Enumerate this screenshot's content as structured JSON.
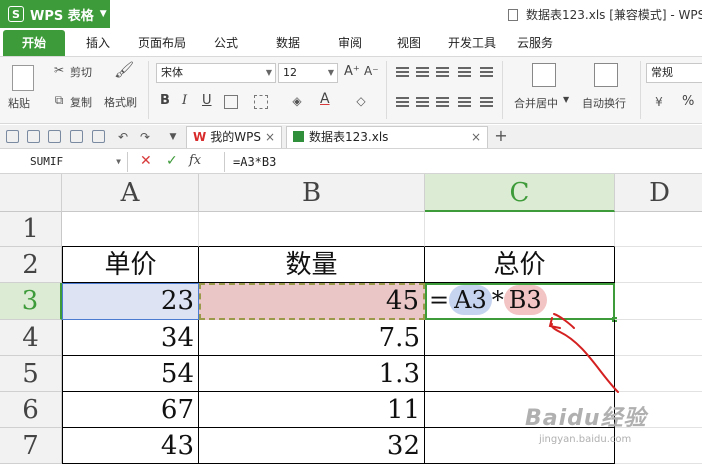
{
  "app": {
    "name": "WPS 表格",
    "logo_letter": "S",
    "doc_title": "数据表123.xls [兼容模式] - WPS"
  },
  "ribbon_tabs": [
    "开始",
    "插入",
    "页面布局",
    "公式",
    "数据",
    "审阅",
    "视图",
    "开发工具",
    "云服务"
  ],
  "ribbon": {
    "paste": "粘贴",
    "cut": "剪切",
    "copy": "复制",
    "format_painter": "格式刷",
    "font_name": "宋体",
    "font_size": "12",
    "merge_center": "合并居中",
    "wrap_text": "自动换行",
    "number_format": "常规",
    "percent": "%",
    "bold": "B",
    "italic": "I",
    "underline": "U",
    "font_color_glyph": "A",
    "grow_font": "A⁺",
    "shrink_font": "A⁻"
  },
  "doc_tabs": [
    {
      "label": "我的WPS",
      "icon": "wps-icon"
    },
    {
      "label": "数据表123.xls",
      "icon": "spreadsheet-icon"
    }
  ],
  "formula_bar": {
    "name_box": "SUMIF",
    "fx": "fx",
    "content": "=A3*B3",
    "cancel_glyph": "✕",
    "confirm_glyph": "✓"
  },
  "sheet": {
    "columns": [
      "A",
      "B",
      "C",
      "D"
    ],
    "rows": [
      "1",
      "2",
      "3",
      "4",
      "5",
      "6",
      "7"
    ],
    "headers": {
      "A2": "单价",
      "B2": "数量",
      "C2": "总价"
    },
    "values": [
      {
        "row": "3",
        "A": "23",
        "B": "45"
      },
      {
        "row": "4",
        "A": "34",
        "B": "7.5"
      },
      {
        "row": "5",
        "A": "54",
        "B": "1.3"
      },
      {
        "row": "6",
        "A": "67",
        "B": "11"
      },
      {
        "row": "7",
        "A": "43",
        "B": "32"
      }
    ],
    "editing_cell": "C3",
    "edit_text": {
      "eq": "=",
      "ref1": "A3",
      "op": "*",
      "ref2": "B3"
    }
  },
  "watermark": {
    "brand": "Baidu经验",
    "url": "jingyan.baidu.com"
  },
  "colors": {
    "accent_green": "#3e9b3a",
    "ref_blue": "#c6d4f0",
    "ref_red": "#f2c4c4",
    "annotation_red": "#d42020"
  }
}
